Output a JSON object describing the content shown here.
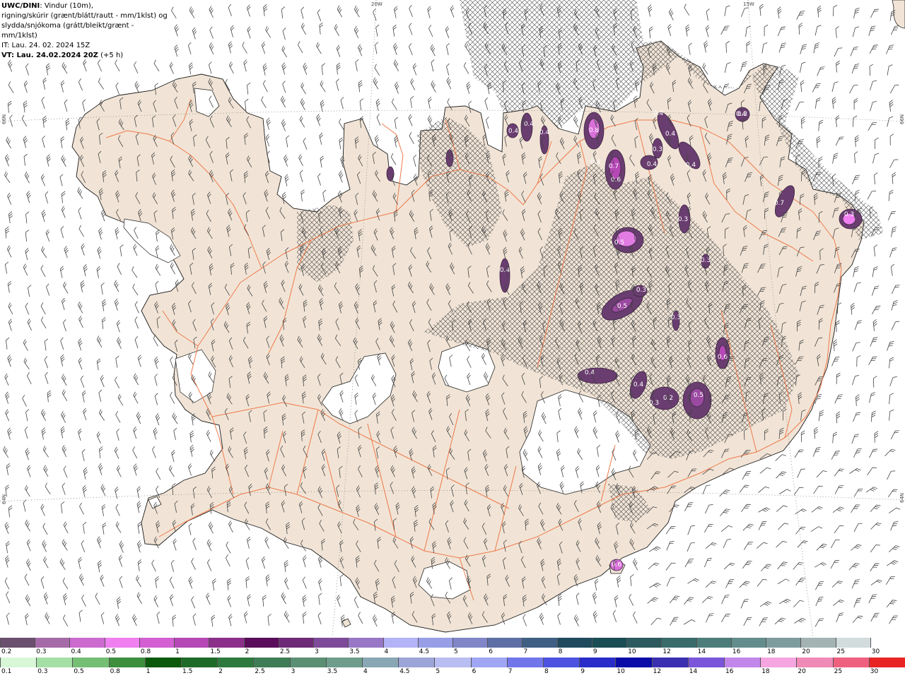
{
  "info": {
    "model": "UWC/DINI",
    "line1_rest": ": Vindur (10m),",
    "line2": "rigning/skúrir (grænt/blátt/rautt - mm/1klst) og",
    "line3": "slydda/snjókoma (grátt/bleikt/grænt - mm/1klst)",
    "line4": "IT: Lau. 24. 02. 2024 15Z",
    "vt_prefix": "VT: Lau. 24.02.2024 20Z",
    "vt_suffix": " (+5 h)"
  },
  "map": {
    "lon_labels": [
      "20W",
      "15W"
    ],
    "lat_labels": [
      "66N",
      "64N"
    ],
    "land_color": "#f1e4d6",
    "road_color": "#ee7a4a",
    "coast_color": "#1a1a1a",
    "wind_barb_color": "#444444",
    "snow_color_light": "#d96fd9",
    "snow_color_dark": "#6a3d70",
    "precip_value_labels": [
      "0.8",
      "0.7",
      "0.6",
      "0.4",
      "0.4",
      "0.4",
      "0.4",
      "0.4",
      "0.3",
      "0.4",
      "0.5",
      "0.3",
      "0.3",
      "0.5",
      "0.3",
      "0.6",
      "0.6",
      "0.4",
      "0.4",
      "0.3",
      "0.2",
      "0.5",
      "0.3",
      "0.7",
      "0.4",
      "0.4",
      "0.4",
      "0.3",
      "0.4",
      "0.3"
    ]
  },
  "legend_snow": {
    "labels": [
      "0.2",
      "0.3",
      "0.4",
      "0.5",
      "0.8",
      "1",
      "1.5",
      "2",
      "2.5",
      "3",
      "3.5",
      "4",
      "4.5",
      "5",
      "6",
      "7",
      "8",
      "9",
      "10",
      "12",
      "14",
      "16",
      "18",
      "20",
      "25",
      "30"
    ],
    "colors": [
      "#6b4f6e",
      "#a56aa8",
      "#cc6ad0",
      "#f07ff0",
      "#d35fd3",
      "#b548b5",
      "#8b2f8b",
      "#5a0d5a",
      "#6d2a76",
      "#7e4a9a",
      "#9877c6",
      "#b3b3f7",
      "#979ee6",
      "#8086c8",
      "#5d6fa4",
      "#3f5f85",
      "#1f4a5e",
      "#1b4d55",
      "#2d5a5e",
      "#3a6b6b",
      "#4d7d7b",
      "#638d8c",
      "#7e9c9d",
      "#a3b3b3",
      "#d2dcdc",
      "#ffffff"
    ]
  },
  "legend_rain": {
    "labels": [
      "0.1",
      "0.3",
      "0.5",
      "0.8",
      "1",
      "1.5",
      "2",
      "2.5",
      "3",
      "3.5",
      "4",
      "4.5",
      "5",
      "6",
      "7",
      "8",
      "9",
      "10",
      "12",
      "14",
      "16",
      "18",
      "20",
      "25",
      "30"
    ],
    "colors": [
      "#d7f7d7",
      "#a5dfa5",
      "#74bf74",
      "#3d8f3d",
      "#0b5a0b",
      "#1e6b28",
      "#2e7a3e",
      "#3e7d55",
      "#5a8f73",
      "#6f9d8c",
      "#8aa7b5",
      "#9ba5d8",
      "#b8bdf2",
      "#a0a6f3",
      "#7176ea",
      "#4d52e0",
      "#2a2cc9",
      "#0b0ba8",
      "#3a2fb0",
      "#7a55d9",
      "#c287ea",
      "#f5a6e0",
      "#f08ab7",
      "#ef607f",
      "#e82424"
    ]
  }
}
